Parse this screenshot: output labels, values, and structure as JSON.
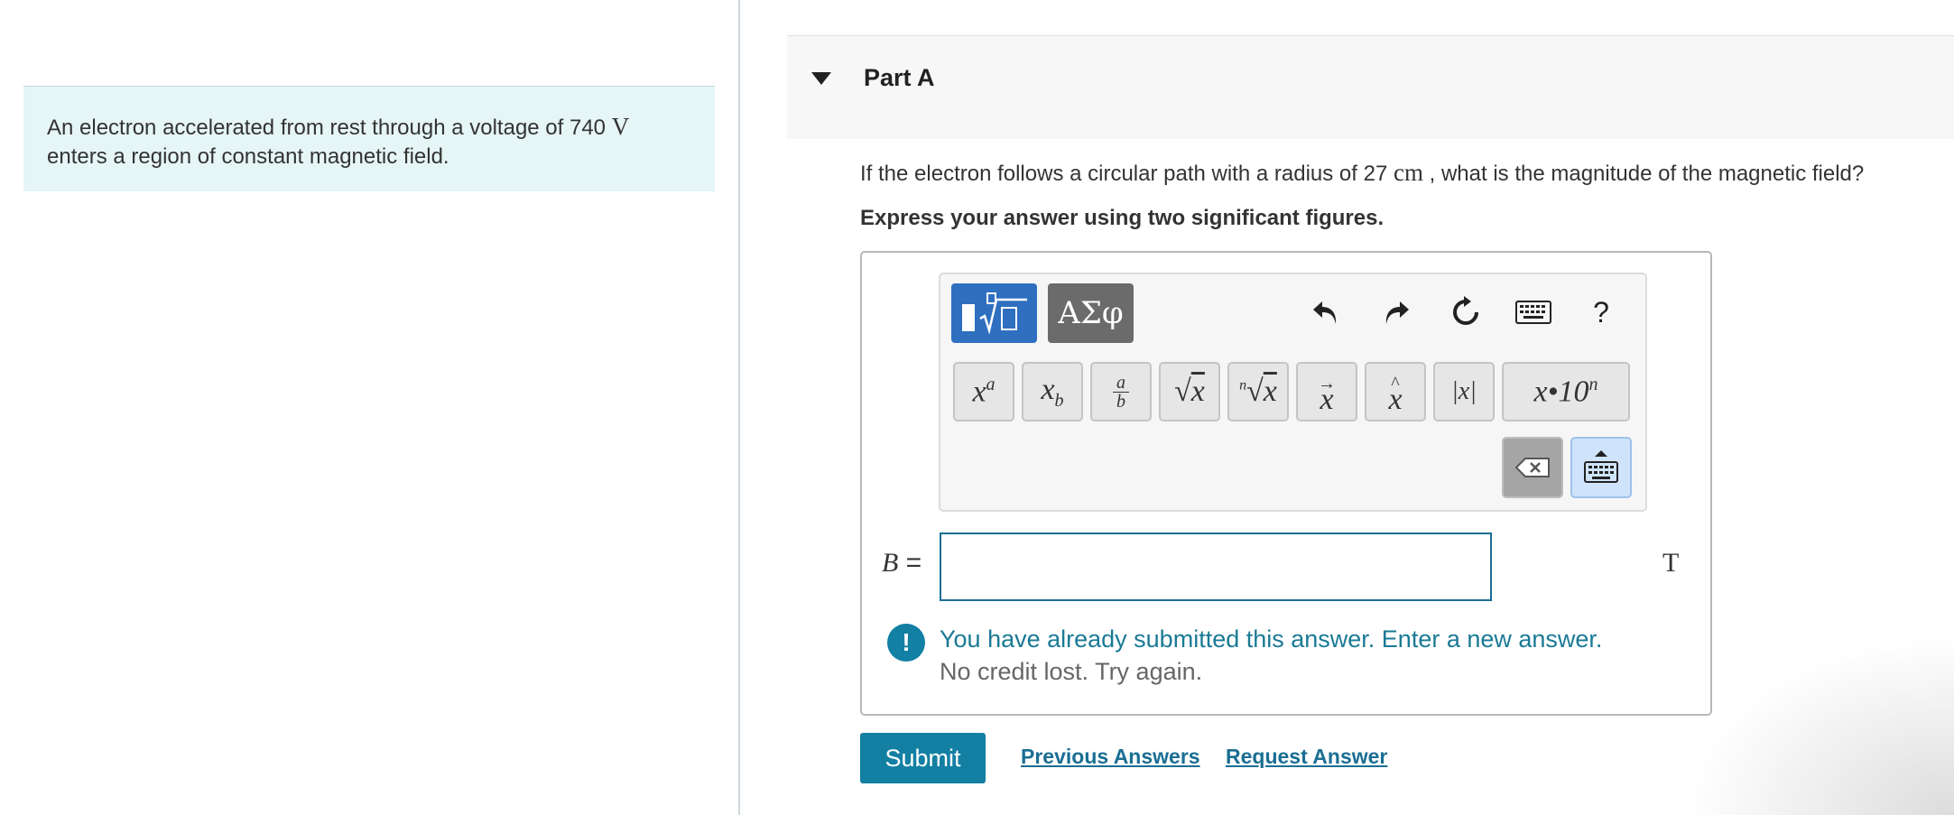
{
  "intro": {
    "text_before": "An electron accelerated from rest through a voltage of 740 ",
    "unit": "V",
    "text_after": "enters a region of constant magnetic field."
  },
  "part": {
    "title": "Part A"
  },
  "question": {
    "text_before": "If the electron follows a circular path with a radius of 27 ",
    "unit": "cm",
    "text_after": " , what is the magnitude of the magnetic field?"
  },
  "instruction": "Express your answer using two significant figures.",
  "toolbar": {
    "greek_tab": "ΑΣφ",
    "help": "?",
    "keys": [
      "xa",
      "xb",
      "a/b",
      "√x",
      "n√x",
      "x→",
      "x^",
      "|x|",
      "x•10n"
    ]
  },
  "answer": {
    "variable": "B",
    "equals": "=",
    "value": "",
    "unit": "T"
  },
  "feedback": {
    "message": "You have already submitted this answer. Enter a new answer.",
    "subtext": "No credit lost. Try again."
  },
  "actions": {
    "submit": "Submit",
    "previous_answers": "Previous Answers",
    "request_answer": "Request Answer"
  },
  "colors": {
    "accent": "#127fa3",
    "intro_bg": "#e6f5f5",
    "template_tab": "#2f6fc0"
  }
}
